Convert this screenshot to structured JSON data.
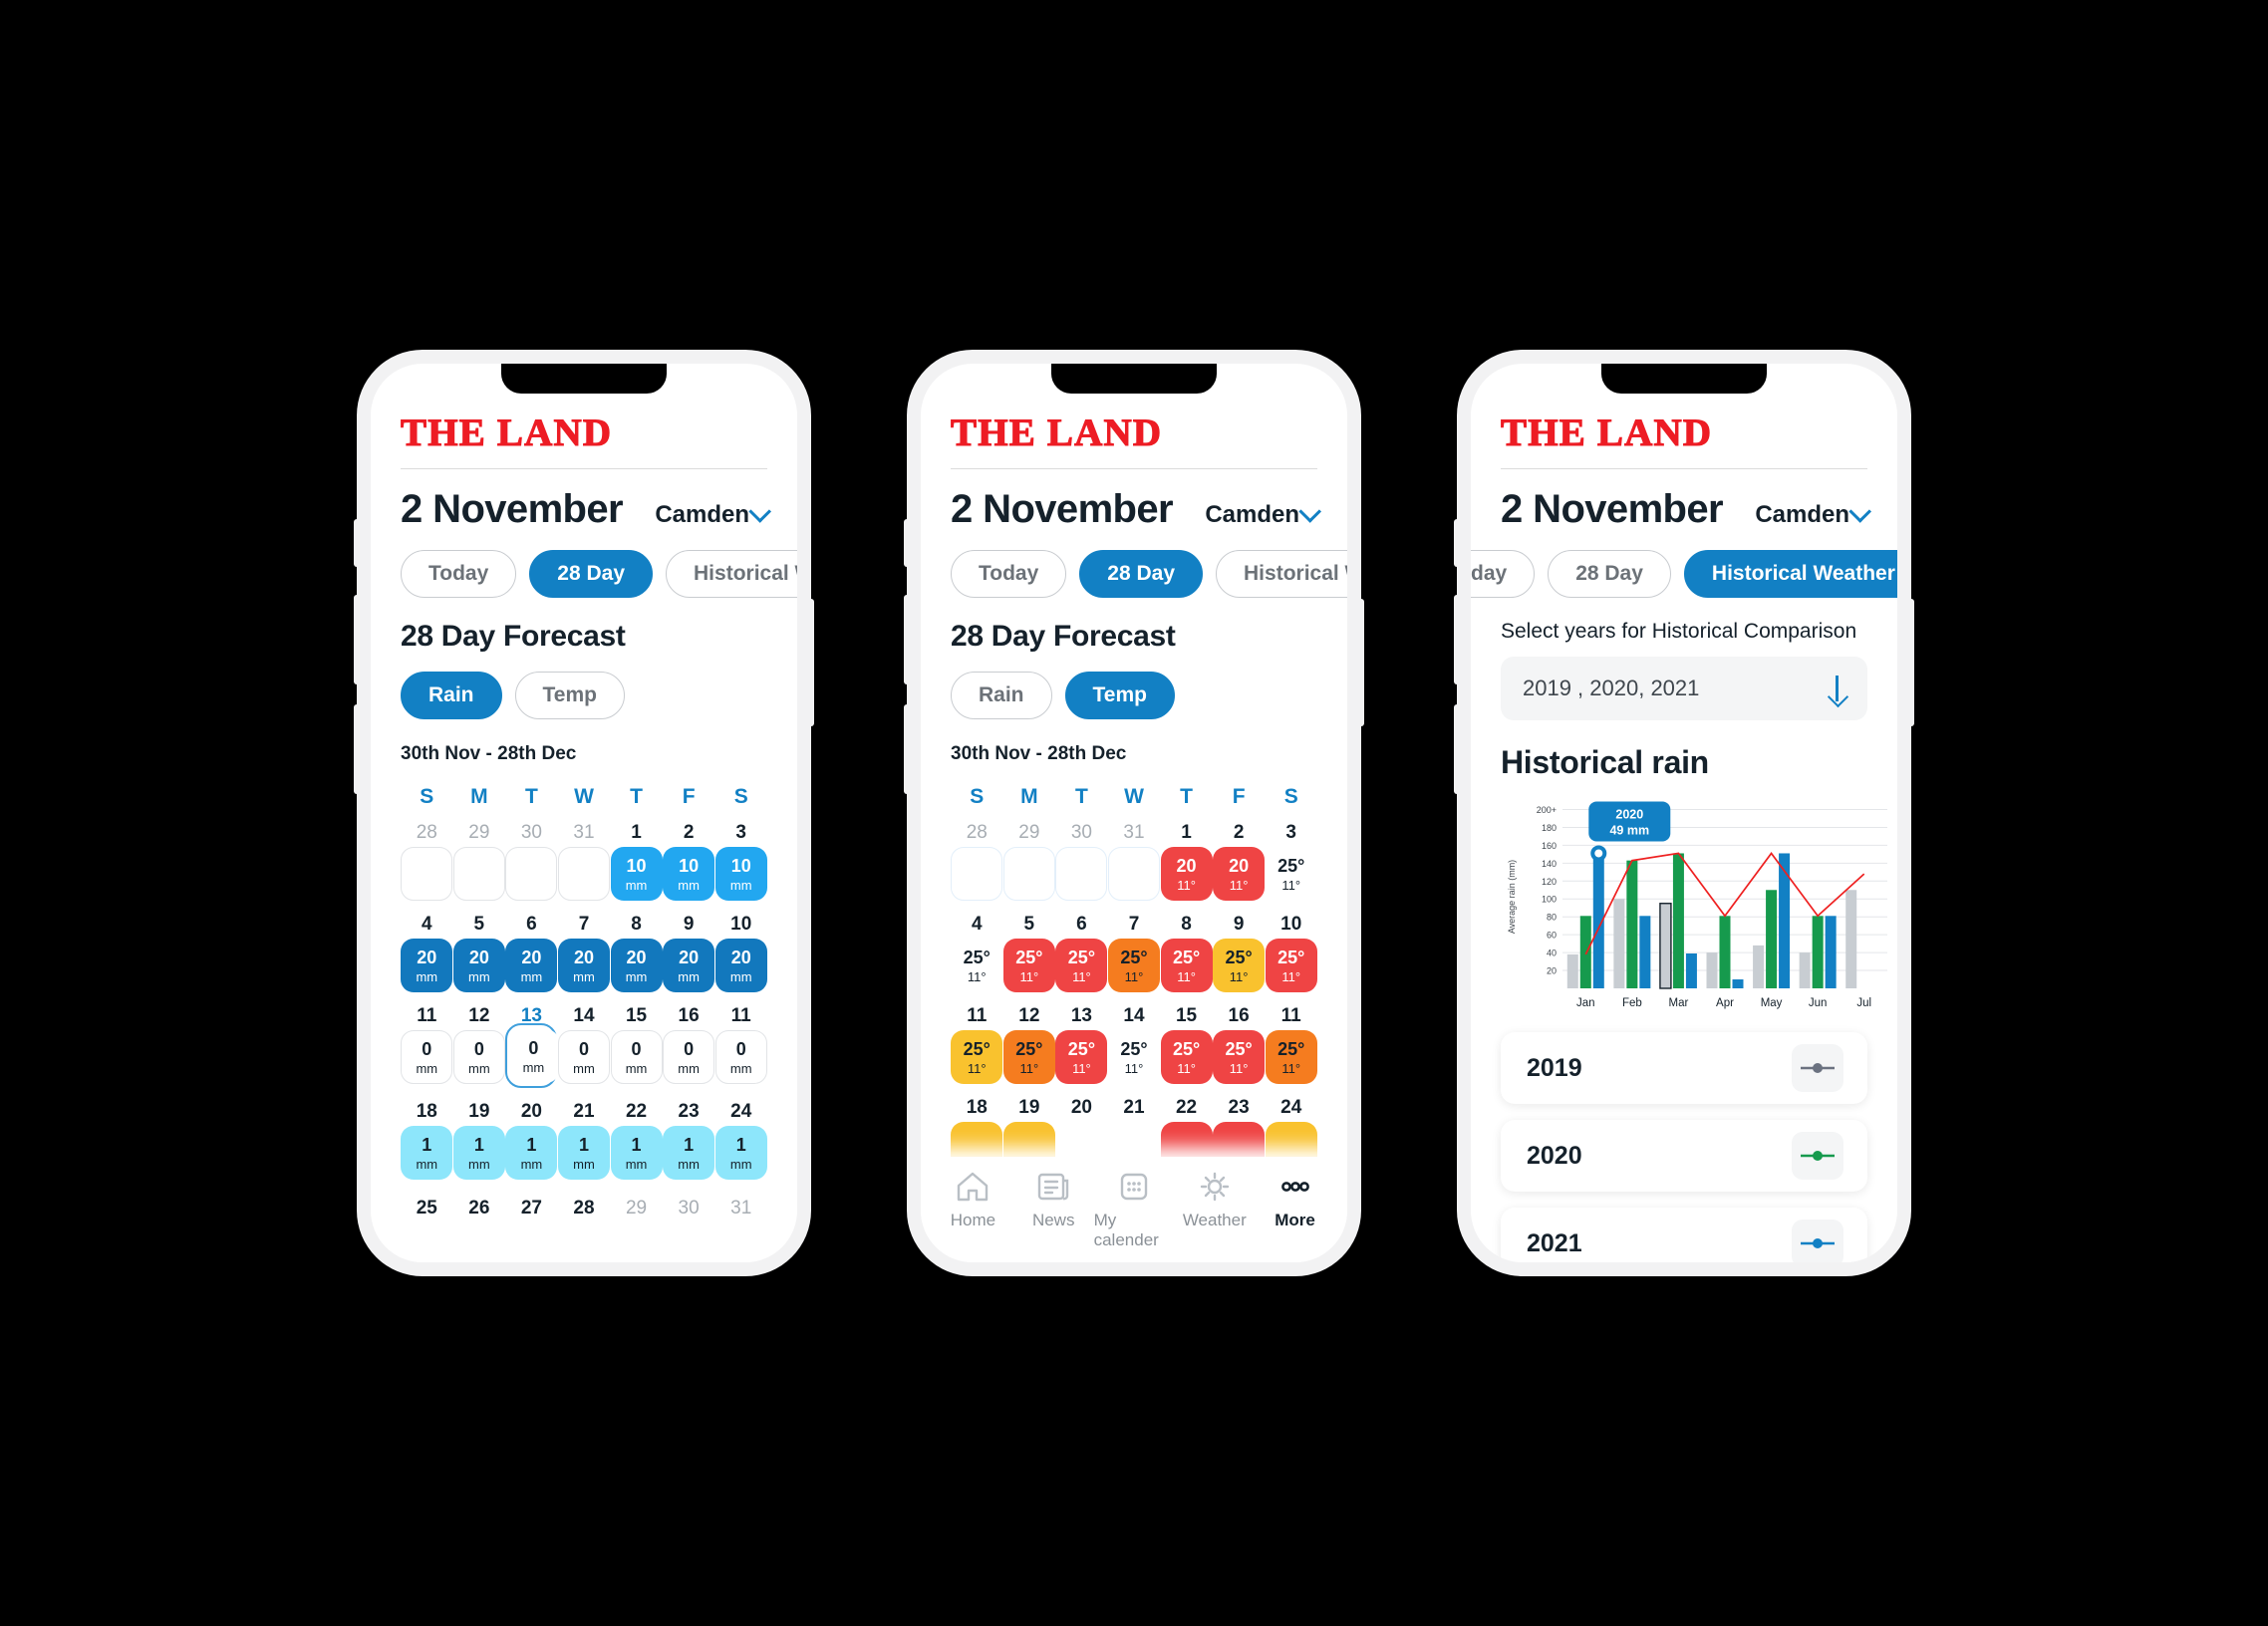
{
  "brand": {
    "masthead": "THE LAND",
    "accent_blue": "#1280c4",
    "red": "#ed1c24"
  },
  "screens": [
    {
      "id": "rain-28day",
      "date_title": "2 November",
      "location": "Camden",
      "location_icon": "chevron-down-icon",
      "tabs": [
        {
          "label": "Today",
          "active": false
        },
        {
          "label": "28 Day",
          "active": true
        },
        {
          "label": "Historical W",
          "active": false
        }
      ],
      "section_title": "28 Day Forecast",
      "metric_tabs": [
        {
          "label": "Rain",
          "active": true
        },
        {
          "label": "Temp",
          "active": false
        }
      ],
      "range_label": "30th Nov - 28th Dec",
      "dow": [
        "S",
        "M",
        "T",
        "W",
        "T",
        "F",
        "S"
      ],
      "weeks": [
        [
          {
            "day": "28",
            "muted": true,
            "style": "empty"
          },
          {
            "day": "29",
            "muted": true,
            "style": "empty"
          },
          {
            "day": "30",
            "muted": true,
            "style": "empty"
          },
          {
            "day": "31",
            "muted": true,
            "style": "empty"
          },
          {
            "day": "1",
            "muted": false,
            "style": "fill",
            "color": "#22a7f0",
            "value": "10",
            "unit": "mm",
            "text": "#ffffff"
          },
          {
            "day": "2",
            "muted": false,
            "style": "fill",
            "color": "#22a7f0",
            "value": "10",
            "unit": "mm",
            "text": "#ffffff"
          },
          {
            "day": "3",
            "muted": false,
            "style": "fill",
            "color": "#22a7f0",
            "value": "10",
            "unit": "mm",
            "text": "#ffffff"
          }
        ],
        [
          {
            "day": "4",
            "muted": false,
            "style": "fill",
            "color": "#1278bd",
            "value": "20",
            "unit": "mm",
            "text": "#ffffff"
          },
          {
            "day": "5",
            "muted": false,
            "style": "fill",
            "color": "#1278bd",
            "value": "20",
            "unit": "mm",
            "text": "#ffffff"
          },
          {
            "day": "6",
            "muted": false,
            "style": "fill",
            "color": "#1278bd",
            "value": "20",
            "unit": "mm",
            "text": "#ffffff"
          },
          {
            "day": "7",
            "muted": false,
            "style": "fill",
            "color": "#1278bd",
            "value": "20",
            "unit": "mm",
            "text": "#ffffff"
          },
          {
            "day": "8",
            "muted": false,
            "style": "fill",
            "color": "#1278bd",
            "value": "20",
            "unit": "mm",
            "text": "#ffffff"
          },
          {
            "day": "9",
            "muted": false,
            "style": "fill",
            "color": "#1278bd",
            "value": "20",
            "unit": "mm",
            "text": "#ffffff"
          },
          {
            "day": "10",
            "muted": false,
            "style": "fill",
            "color": "#1278bd",
            "value": "20",
            "unit": "mm",
            "text": "#ffffff"
          }
        ],
        [
          {
            "day": "11",
            "muted": false,
            "style": "zero",
            "value": "0",
            "unit": "mm"
          },
          {
            "day": "12",
            "muted": false,
            "style": "zero",
            "value": "0",
            "unit": "mm"
          },
          {
            "day": "13",
            "muted": false,
            "style": "zero",
            "value": "0",
            "unit": "mm",
            "selected": true
          },
          {
            "day": "14",
            "muted": false,
            "style": "zero",
            "value": "0",
            "unit": "mm"
          },
          {
            "day": "15",
            "muted": false,
            "style": "zero",
            "value": "0",
            "unit": "mm"
          },
          {
            "day": "16",
            "muted": false,
            "style": "zero",
            "value": "0",
            "unit": "mm"
          },
          {
            "day": "11",
            "muted": false,
            "style": "zero",
            "value": "0",
            "unit": "mm"
          }
        ],
        [
          {
            "day": "18",
            "muted": false,
            "style": "fill",
            "color": "#8de6fb",
            "value": "1",
            "unit": "mm",
            "text": "#15212b"
          },
          {
            "day": "19",
            "muted": false,
            "style": "fill",
            "color": "#8de6fb",
            "value": "1",
            "unit": "mm",
            "text": "#15212b"
          },
          {
            "day": "20",
            "muted": false,
            "style": "fill",
            "color": "#8de6fb",
            "value": "1",
            "unit": "mm",
            "text": "#15212b"
          },
          {
            "day": "21",
            "muted": false,
            "style": "fill",
            "color": "#8de6fb",
            "value": "1",
            "unit": "mm",
            "text": "#15212b"
          },
          {
            "day": "22",
            "muted": false,
            "style": "fill",
            "color": "#8de6fb",
            "value": "1",
            "unit": "mm",
            "text": "#15212b"
          },
          {
            "day": "23",
            "muted": false,
            "style": "fill",
            "color": "#8de6fb",
            "value": "1",
            "unit": "mm",
            "text": "#15212b"
          },
          {
            "day": "24",
            "muted": false,
            "style": "fill",
            "color": "#8de6fb",
            "value": "1",
            "unit": "mm",
            "text": "#15212b"
          }
        ]
      ],
      "last_row": [
        {
          "day": "25",
          "muted": false
        },
        {
          "day": "26",
          "muted": false
        },
        {
          "day": "27",
          "muted": false
        },
        {
          "day": "28",
          "muted": false
        },
        {
          "day": "29",
          "muted": true
        },
        {
          "day": "30",
          "muted": true
        },
        {
          "day": "31",
          "muted": true
        }
      ]
    },
    {
      "id": "temp-28day",
      "date_title": "2 November",
      "location": "Camden",
      "location_icon": "chevron-down-icon",
      "tabs": [
        {
          "label": "Today",
          "active": false
        },
        {
          "label": "28 Day",
          "active": true
        },
        {
          "label": "Historical W",
          "active": false
        }
      ],
      "section_title": "28 Day Forecast",
      "metric_tabs": [
        {
          "label": "Rain",
          "active": false
        },
        {
          "label": "Temp",
          "active": true
        }
      ],
      "range_label": "30th Nov - 28th Dec",
      "dow": [
        "S",
        "M",
        "T",
        "W",
        "T",
        "F",
        "S"
      ],
      "weeks": [
        [
          {
            "day": "28",
            "muted": true,
            "style": "empty-blue"
          },
          {
            "day": "29",
            "muted": true,
            "style": "empty-blue"
          },
          {
            "day": "30",
            "muted": true,
            "style": "empty-blue"
          },
          {
            "day": "31",
            "muted": true,
            "style": "empty-blue"
          },
          {
            "day": "1",
            "muted": false,
            "style": "fill",
            "color": "#ef4444",
            "value": "20",
            "unit": "11°",
            "text": "#ffffff"
          },
          {
            "day": "2",
            "muted": false,
            "style": "fill",
            "color": "#ef4444",
            "value": "20",
            "unit": "11°",
            "text": "#ffffff"
          },
          {
            "day": "3",
            "muted": false,
            "style": "plain",
            "value": "25°",
            "unit": "11°"
          }
        ],
        [
          {
            "day": "4",
            "muted": false,
            "style": "plain",
            "value": "25°",
            "unit": "11°"
          },
          {
            "day": "5",
            "muted": false,
            "style": "fill",
            "color": "#ef4444",
            "value": "25°",
            "unit": "11°",
            "text": "#ffffff"
          },
          {
            "day": "6",
            "muted": false,
            "style": "fill",
            "color": "#ef4444",
            "value": "25°",
            "unit": "11°",
            "text": "#ffffff"
          },
          {
            "day": "7",
            "muted": false,
            "style": "fill",
            "color": "#f57c1f",
            "value": "25°",
            "unit": "11°",
            "text": "#15212b"
          },
          {
            "day": "8",
            "muted": false,
            "style": "fill",
            "color": "#ef4444",
            "value": "25°",
            "unit": "11°",
            "text": "#ffffff"
          },
          {
            "day": "9",
            "muted": false,
            "style": "fill",
            "color": "#f9c22e",
            "value": "25°",
            "unit": "11°",
            "text": "#15212b"
          },
          {
            "day": "10",
            "muted": false,
            "style": "fill",
            "color": "#ef4444",
            "value": "25°",
            "unit": "11°",
            "text": "#ffffff"
          }
        ],
        [
          {
            "day": "11",
            "muted": false,
            "style": "fill",
            "color": "#f9c22e",
            "value": "25°",
            "unit": "11°",
            "text": "#15212b"
          },
          {
            "day": "12",
            "muted": false,
            "style": "fill",
            "color": "#f57c1f",
            "value": "25°",
            "unit": "11°",
            "text": "#15212b"
          },
          {
            "day": "13",
            "muted": false,
            "style": "fill",
            "color": "#ef4444",
            "value": "25°",
            "unit": "11°",
            "text": "#ffffff"
          },
          {
            "day": "14",
            "muted": false,
            "style": "plain",
            "value": "25°",
            "unit": "11°"
          },
          {
            "day": "15",
            "muted": false,
            "style": "fill",
            "color": "#ef4444",
            "value": "25°",
            "unit": "11°",
            "text": "#ffffff"
          },
          {
            "day": "16",
            "muted": false,
            "style": "fill",
            "color": "#ef4444",
            "value": "25°",
            "unit": "11°",
            "text": "#ffffff"
          },
          {
            "day": "11",
            "muted": false,
            "style": "fill",
            "color": "#f57c1f",
            "value": "25°",
            "unit": "11°",
            "text": "#15212b"
          }
        ],
        [
          {
            "day": "18",
            "muted": false,
            "style": "fill",
            "color": "#f9c22e",
            "value": "",
            "unit": "",
            "text": "#15212b"
          },
          {
            "day": "19",
            "muted": false,
            "style": "fill",
            "color": "#f9c22e",
            "value": "",
            "unit": "",
            "text": "#15212b"
          },
          {
            "day": "20",
            "muted": false,
            "style": "plain",
            "value": "",
            "unit": ""
          },
          {
            "day": "21",
            "muted": false,
            "style": "plain",
            "value": "",
            "unit": ""
          },
          {
            "day": "22",
            "muted": false,
            "style": "fill",
            "color": "#ef4444",
            "value": "",
            "unit": "",
            "text": "#ffffff"
          },
          {
            "day": "23",
            "muted": false,
            "style": "fill",
            "color": "#ef4444",
            "value": "",
            "unit": "",
            "text": "#ffffff"
          },
          {
            "day": "24",
            "muted": false,
            "style": "fill",
            "color": "#f9c22e",
            "value": "",
            "unit": "",
            "text": "#15212b"
          }
        ]
      ],
      "tabbar": [
        {
          "label": "Home",
          "icon": "home-icon",
          "active": false
        },
        {
          "label": "News",
          "icon": "news-icon",
          "active": false
        },
        {
          "label": "My calender",
          "icon": "calendar-icon",
          "active": false
        },
        {
          "label": "Weather",
          "icon": "sun-icon",
          "active": false
        },
        {
          "label": "More",
          "icon": "more-icon",
          "active": true
        }
      ]
    },
    {
      "id": "historical",
      "date_title": "2 November",
      "location": "Camden",
      "location_icon": "chevron-down-icon",
      "tabs": [
        {
          "label": "day",
          "active": false
        },
        {
          "label": "28 Day",
          "active": false
        },
        {
          "label": "Historical Weather",
          "active": true
        }
      ],
      "select_label": "Select years for Historical Comparison",
      "select_value": "2019 , 2020, 2021",
      "select_icon": "arrow-down-icon",
      "hist_title": "Historical rain",
      "legend": [
        {
          "year": "2019",
          "color": "#6b7280"
        },
        {
          "year": "2020",
          "color": "#169a4d"
        },
        {
          "year": "2021",
          "color": "#1280c4"
        }
      ]
    }
  ],
  "chart_data": {
    "type": "bar",
    "title": "Historical rain",
    "xlabel": "",
    "ylabel": "Average rain (mm)",
    "ylim": [
      0,
      200
    ],
    "yticks": [
      20,
      40,
      60,
      80,
      100,
      120,
      140,
      160,
      180,
      "200+"
    ],
    "grid": true,
    "legend_position": "below-chart",
    "categories": [
      "Jan",
      "Feb",
      "Mar",
      "Apr",
      "May",
      "Jun",
      "Jul"
    ],
    "series": [
      {
        "name": "2019",
        "color": "#c8cdd2",
        "values": [
          38,
          100,
          95,
          40,
          48,
          40,
          110
        ]
      },
      {
        "name": "2020",
        "color": "#169a4d",
        "values": [
          81,
          143,
          151,
          81,
          110,
          81,
          0
        ]
      },
      {
        "name": "2021",
        "color": "#1280c4",
        "values": [
          151,
          81,
          39,
          10,
          151,
          81,
          0
        ]
      }
    ],
    "overlay_line": {
      "name": "average",
      "color": "#ee2020",
      "values": [
        38,
        143,
        151,
        81,
        151,
        81,
        128
      ]
    },
    "highlight": {
      "series": "2020",
      "category": "Jan",
      "tooltip_year": "2020",
      "tooltip_value": "49 mm",
      "marker_color": "#1280c4"
    },
    "selected_bar": {
      "series": "2019",
      "category": "Mar"
    }
  }
}
